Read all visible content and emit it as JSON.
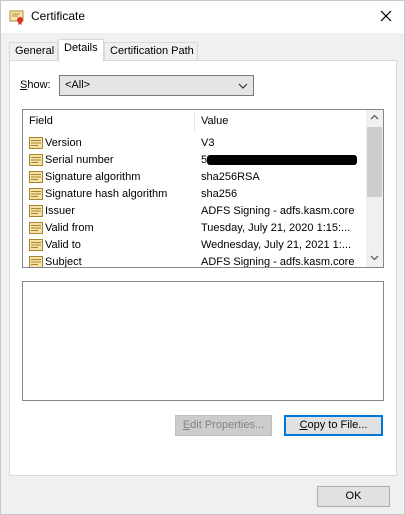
{
  "window": {
    "title": "Certificate",
    "icon": "certificate-icon"
  },
  "tabs": [
    {
      "label": "General",
      "active": false
    },
    {
      "label": "Details",
      "active": true
    },
    {
      "label": "Certification Path",
      "active": false
    }
  ],
  "show": {
    "label_prefix": "S",
    "label_rest": "how:",
    "selected": "<All>"
  },
  "list": {
    "columns": [
      "Field",
      "Value"
    ],
    "rows": [
      {
        "field": "Version",
        "value": "V3"
      },
      {
        "field": "Serial number",
        "value": "5",
        "redacted": true
      },
      {
        "field": "Signature algorithm",
        "value": "sha256RSA"
      },
      {
        "field": "Signature hash algorithm",
        "value": "sha256"
      },
      {
        "field": "Issuer",
        "value": "ADFS Signing - adfs.kasm.core"
      },
      {
        "field": "Valid from",
        "value": "Tuesday, July 21, 2020 1:15:..."
      },
      {
        "field": "Valid to",
        "value": "Wednesday, July 21, 2021 1:..."
      },
      {
        "field": "Subject",
        "value": "ADFS Signing - adfs.kasm.core"
      }
    ]
  },
  "buttons": {
    "edit_properties": {
      "prefix": "E",
      "rest": "dit Properties..."
    },
    "copy_to_file": {
      "prefix": "C",
      "rest": "opy to File..."
    },
    "ok": "OK"
  },
  "colors": {
    "focus_border": "#0078d7",
    "disabled_text": "#838383"
  }
}
